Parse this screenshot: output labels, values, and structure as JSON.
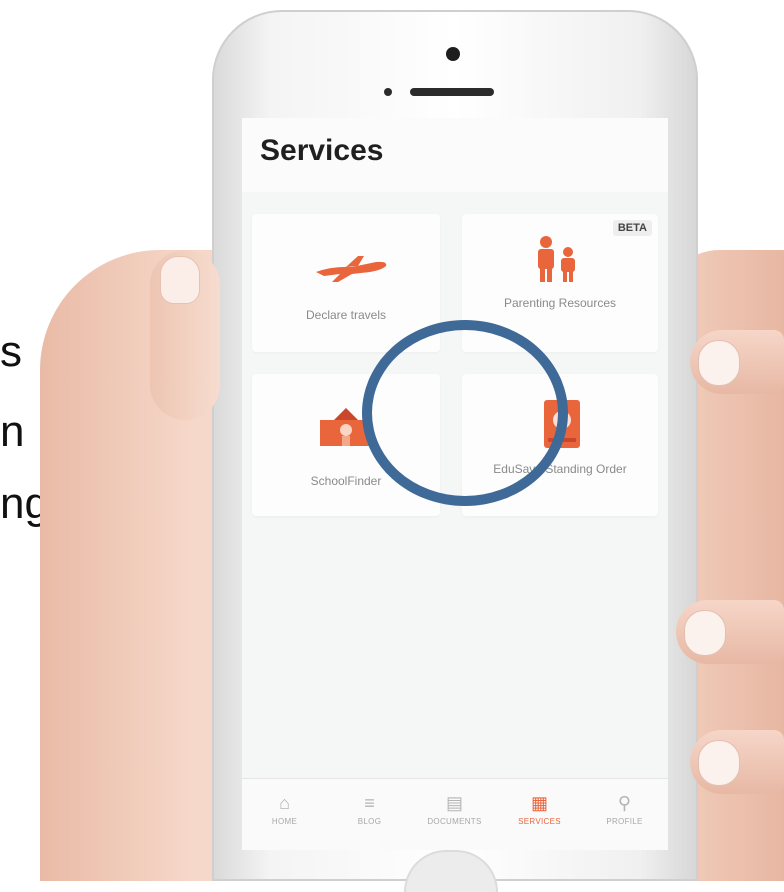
{
  "side_text": {
    "line1": "s",
    "line2": "n",
    "line3": "ng"
  },
  "screen": {
    "title": "Services",
    "tiles": [
      {
        "label": "Declare travels",
        "icon": "airplane-icon",
        "badge": ""
      },
      {
        "label": "Parenting Resources",
        "icon": "family-icon",
        "badge": "BETA"
      },
      {
        "label": "SchoolFinder",
        "icon": "school-icon",
        "badge": ""
      },
      {
        "label": "EduSave Standing Order",
        "icon": "edusave-book-icon",
        "badge": ""
      }
    ],
    "tabs": [
      {
        "label": "HOME",
        "icon": "home-icon"
      },
      {
        "label": "BLOG",
        "icon": "blog-icon"
      },
      {
        "label": "DOCUMENTS",
        "icon": "documents-icon"
      },
      {
        "label": "SERVICES",
        "icon": "grid-icon",
        "active": true
      },
      {
        "label": "PROFILE",
        "icon": "profile-icon"
      }
    ]
  },
  "colors": {
    "accent": "#e9663d",
    "overlay_ring": "#3f6a98",
    "screen_bg": "#f5f6f6"
  }
}
